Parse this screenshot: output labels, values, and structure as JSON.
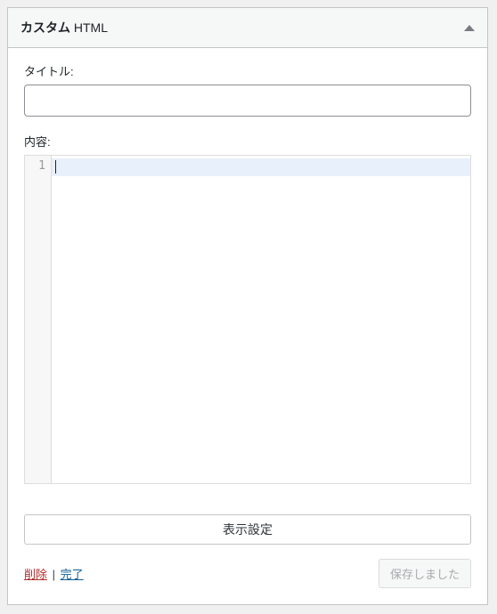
{
  "header": {
    "title_bold": "カスタム",
    "title_thin": " HTML"
  },
  "fields": {
    "title_label": "タイトル:",
    "title_value": "",
    "content_label": "内容:",
    "line_number": "1",
    "content_value": ""
  },
  "buttons": {
    "display_settings": "表示設定",
    "saved": "保存しました"
  },
  "footer": {
    "delete": "削除",
    "separator": " | ",
    "done": "完了"
  }
}
